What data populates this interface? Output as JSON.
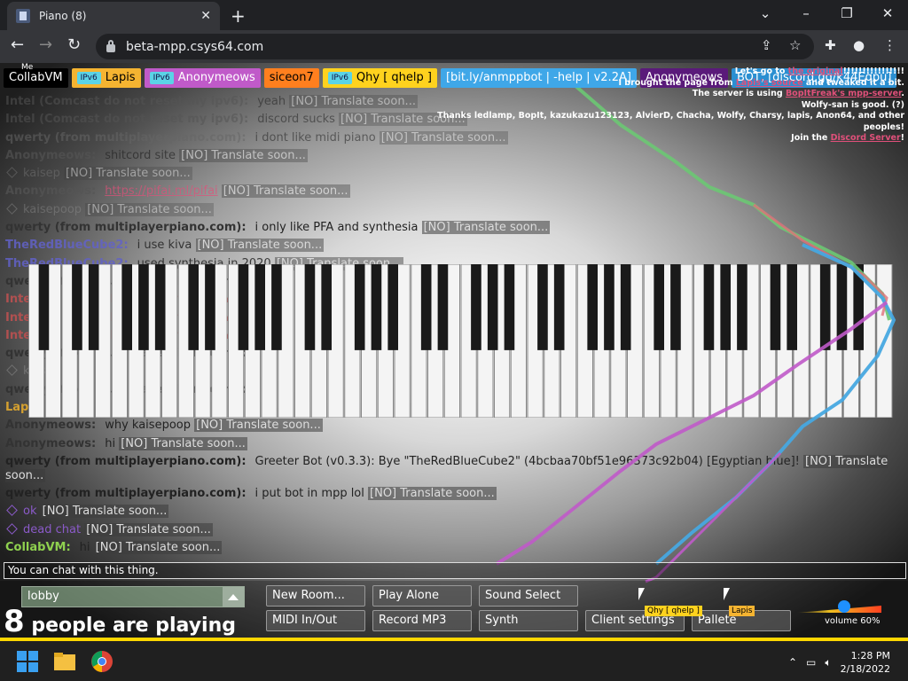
{
  "browser": {
    "tab_title": "Piano (8)",
    "url": "beta-mpp.csys64.com"
  },
  "userbar": [
    {
      "name": "CollabVM",
      "me": "Me",
      "ipv6": false,
      "color": "#000000",
      "text": "#ffffff"
    },
    {
      "name": "Lapis",
      "ipv6": true,
      "color": "#f5b431",
      "text": "#000000"
    },
    {
      "name": "Anonymeows",
      "ipv6": true,
      "color": "#c05ac9",
      "text": "#ffffff"
    },
    {
      "name": "siceon7",
      "ipv6": false,
      "color": "#ff7f1e",
      "text": "#000000"
    },
    {
      "name": "Qhy [ qhelp ]",
      "ipv6": true,
      "color": "#ffd21e",
      "text": "#000000"
    },
    {
      "name": "[bit.ly/anmppbot | -help | v2.2A]",
      "ipv6": false,
      "color": "#3fa7e8",
      "text": "#ffffff"
    },
    {
      "name": "Anonymeows",
      "ipv6": false,
      "color": "#5a1a7a",
      "text": "#ffffff"
    },
    {
      "name": "BOT, [discord.gg/k44Eqpu]",
      "ipv6": false,
      "color": "#2b8fd1",
      "text": "#ffffff"
    }
  ],
  "notice": {
    "l1a": "Let's go to ",
    "l1link": "the original",
    "l1b": "!!!!!!!!!!!!!!!!",
    "l2a": "I brought the page from ",
    "l2link": "Lapis's source",
    "l2b": " and tweaked it a bit.",
    "l3a": "The server is using ",
    "l3link": "BopItFreak's mpp-server",
    "l3b": ".",
    "l4": "Wolfy-san is good. (?)",
    "l5": "Thanks ledlamp, BopIt, kazukazu123123, AlvierD, Chacha, Wolfy, Charsy, lapis, Anon64, and other peoples!",
    "l6a": "Join the ",
    "l6link": "Discord Server",
    "l6b": "!"
  },
  "chat": [
    {
      "name": "Intel (Comcast do not reset my ipv6):",
      "text": "yeah",
      "tr": "[NO] Translate soon...",
      "color": "#555555",
      "op": 0.55,
      "icon": false
    },
    {
      "name": "Intel (Comcast do not reset my ipv6):",
      "text": "discord sucks",
      "tr": "[NO] Translate soon...",
      "color": "#555555",
      "op": 0.55,
      "icon": false
    },
    {
      "name": "qwerty (from multiplayerpiano.com):",
      "text": "i dont like midi piano",
      "tr": "[NO] Translate soon...",
      "color": "#666666",
      "op": 0.55,
      "icon": false
    },
    {
      "name": "Anonymeows:",
      "text": "shitcord site",
      "tr": "[NO] Translate soon...",
      "color": "#555555",
      "op": 0.65,
      "icon": false
    },
    {
      "name": "",
      "text": "kaisep",
      "tr": "[NO] Translate soon...",
      "color": "#777777",
      "op": 0.5,
      "icon": true
    },
    {
      "name": "Anonymeows:",
      "text": "https://pifai.ml/pifai",
      "tr": "[NO] Translate soon...",
      "color": "#555555",
      "op": 0.7,
      "icon": false,
      "link": true
    },
    {
      "name": "",
      "text": "kaisepoop",
      "tr": "[NO] Translate soon...",
      "color": "#888888",
      "op": 0.5,
      "icon": true
    },
    {
      "name": "qwerty (from multiplayerpiano.com):",
      "text": "i only like PFA and synthesia",
      "tr": "[NO] Translate soon...",
      "color": "#333333",
      "op": 1,
      "icon": false
    },
    {
      "name": "TheRedBlueCube2:",
      "text": "i use kiva",
      "tr": "[NO] Translate soon...",
      "color": "#6262c8",
      "op": 0.85,
      "icon": false
    },
    {
      "name": "TheRedBlueCube2:",
      "text": "used synthesia in 2020",
      "tr": "[NO] Translate soon...",
      "color": "#6262c8",
      "op": 0.85,
      "icon": false
    },
    {
      "name": "qwerty (from multiplayerpiano.com):",
      "text": "",
      "tr": "",
      "color": "#333333",
      "op": 1,
      "icon": false
    },
    {
      "name": "Intel (Comcast do not reset my ipv6):",
      "text": "",
      "tr": "",
      "color": "#b05050",
      "op": 1,
      "icon": false
    },
    {
      "name": "Intel (Comcast do not reset my ipv6):",
      "text": "",
      "tr": "",
      "color": "#b05050",
      "op": 1,
      "icon": false
    },
    {
      "name": "Intel (Comcast do not reset my ipv6):",
      "text": "",
      "tr": "",
      "color": "#b05050",
      "op": 1,
      "icon": false
    },
    {
      "name": "qwerty (from multiplayerpiano.com):",
      "text": "",
      "tr": "",
      "color": "#333333",
      "op": 1,
      "icon": false
    },
    {
      "name": "",
      "text": "kaisep",
      "tr": "",
      "color": "#888888",
      "op": 0.6,
      "icon": true
    },
    {
      "name": "qwerty (from multiplayerpiano.com):",
      "text": "",
      "tr": "",
      "color": "#333333",
      "op": 1,
      "icon": false
    },
    {
      "name": "Lapis:",
      "text": "",
      "tr": "",
      "color": "#d4a030",
      "op": 1,
      "icon": false
    },
    {
      "name": "Anonymeows:",
      "text": "why kaisepoop",
      "tr": "[NO] Translate soon...",
      "color": "#333333",
      "op": 1,
      "icon": false
    },
    {
      "name": "Anonymeows:",
      "text": "hi",
      "tr": "[NO] Translate soon...",
      "color": "#333333",
      "op": 1,
      "icon": false
    },
    {
      "name": "qwerty (from multiplayerpiano.com):",
      "text": "Greeter Bot (v0.3.3): Bye \"TheRedBlueCube2\" (4bcbaa70bf51e96373c92b04) [Egyptian blue]!",
      "tr": "[NO] Translate soon...",
      "color": "#222222",
      "op": 1,
      "icon": false,
      "wrap": true
    },
    {
      "name": "qwerty (from multiplayerpiano.com):",
      "text": "i put bot in mpp lol",
      "tr": "[NO] Translate soon...",
      "color": "#222222",
      "op": 1,
      "icon": false
    },
    {
      "name": "",
      "text": "ok",
      "tr": "[NO] Translate soon...",
      "color": "#8a5ac8",
      "op": 1,
      "icon": true
    },
    {
      "name": "",
      "text": "dead chat",
      "tr": "[NO] Translate soon...",
      "color": "#8a5ac8",
      "op": 1,
      "icon": true
    },
    {
      "name": "CollabVM:",
      "text": "hi",
      "tr": "[NO] Translate soon...",
      "color": "#8fd14f",
      "op": 1,
      "icon": false
    }
  ],
  "chat_input_placeholder": "You can chat with this thing.",
  "room": {
    "name": "lobby",
    "count": "8",
    "count_suffix": " people are playing"
  },
  "buttons": {
    "new_room": "New Room...",
    "play_alone": "Play Alone",
    "sound_select": "Sound Select",
    "midi": "MIDI In/Out",
    "record": "Record MP3",
    "synth": "Synth",
    "client_settings": "Client settings",
    "pallete": "Pallete"
  },
  "cursors": [
    {
      "name": "Qhy [ qhelp ]",
      "color": "#ffd21e"
    },
    {
      "name": "Lapis",
      "color": "#f5b431"
    }
  ],
  "volume": {
    "label": "volume 60%",
    "value": 0.6
  },
  "taskbar": {
    "time": "1:28 PM",
    "date": "2/18/2022"
  }
}
